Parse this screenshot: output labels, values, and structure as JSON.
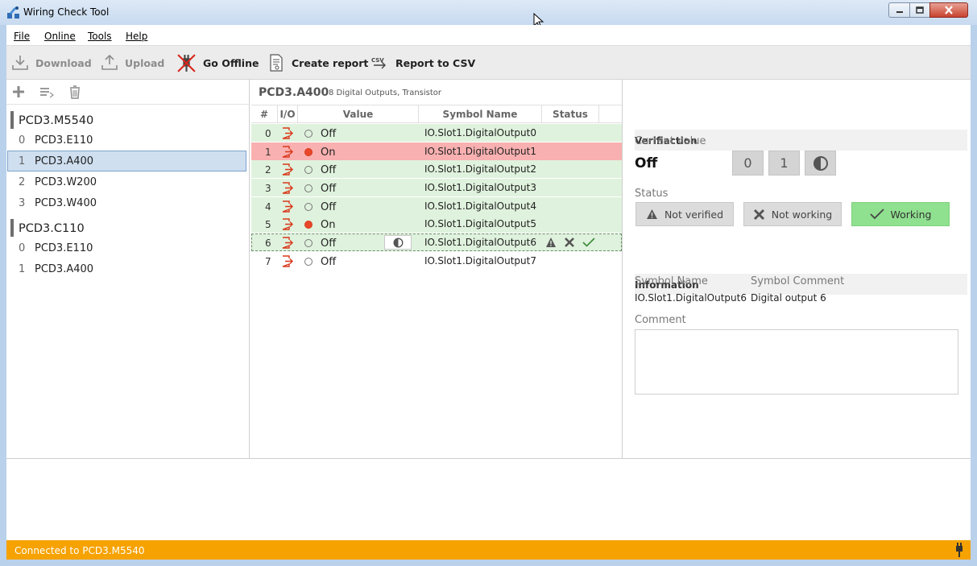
{
  "window": {
    "title": "Wiring Check Tool"
  },
  "menu": {
    "items": [
      "File",
      "Online",
      "Tools",
      "Help"
    ]
  },
  "toolbar": {
    "download_label": "Download",
    "upload_label": "Upload",
    "go_offline_label": "Go Offline",
    "create_report_label": "Create report",
    "report_csv_label": "Report to CSV"
  },
  "tree": {
    "groups": [
      {
        "name": "PCD3.M5540",
        "items": [
          {
            "idx": "0",
            "name": "PCD3.E110"
          },
          {
            "idx": "1",
            "name": "PCD3.A400",
            "selected": true
          },
          {
            "idx": "2",
            "name": "PCD3.W200"
          },
          {
            "idx": "3",
            "name": "PCD3.W400"
          }
        ]
      },
      {
        "name": "PCD3.C110",
        "items": [
          {
            "idx": "0",
            "name": "PCD3.E110"
          },
          {
            "idx": "1",
            "name": "PCD3.A400"
          }
        ]
      }
    ]
  },
  "module": {
    "title": "PCD3.A400",
    "subtitle": "8 Digital Outputs, Transistor"
  },
  "grid": {
    "headers": {
      "num": "#",
      "io": "I/O",
      "value": "Value",
      "symbol": "Symbol Name",
      "status": "Status"
    },
    "rows": [
      {
        "num": "0",
        "value": "Off",
        "on": false,
        "symbol": "IO.Slot1.DigitalOutput0",
        "state": "ok"
      },
      {
        "num": "1",
        "value": "On",
        "on": true,
        "symbol": "IO.Slot1.DigitalOutput1",
        "state": "fail"
      },
      {
        "num": "2",
        "value": "Off",
        "on": false,
        "symbol": "IO.Slot1.DigitalOutput2",
        "state": "ok"
      },
      {
        "num": "3",
        "value": "Off",
        "on": false,
        "symbol": "IO.Slot1.DigitalOutput3",
        "state": "ok"
      },
      {
        "num": "4",
        "value": "Off",
        "on": false,
        "symbol": "IO.Slot1.DigitalOutput4",
        "state": "ok"
      },
      {
        "num": "5",
        "value": "On",
        "on": true,
        "symbol": "IO.Slot1.DigitalOutput5",
        "state": "ok"
      },
      {
        "num": "6",
        "value": "Off",
        "on": false,
        "symbol": "IO.Slot1.DigitalOutput6",
        "state": "selected"
      },
      {
        "num": "7",
        "value": "Off",
        "on": false,
        "symbol": "IO.Slot1.DigitalOutput7",
        "state": "none"
      }
    ]
  },
  "verification": {
    "section_title": "Verifiaction",
    "current_value_label": "Current value",
    "current_value": "Off",
    "btn_zero": "0",
    "btn_one": "1",
    "status_label": "Status",
    "not_verified_label": "Not verified",
    "not_working_label": "Not working",
    "working_label": "Working"
  },
  "information": {
    "section_title": "Information",
    "symbol_name_label": "Symbol Name",
    "symbol_name_value": "IO.Slot1.DigitalOutput6",
    "symbol_comment_label": "Symbol Comment",
    "symbol_comment_value": "Digital output 6",
    "comment_label": "Comment",
    "comment_value": ""
  },
  "statusbar": {
    "text": "Connected to PCD3.M5540"
  },
  "colors": {
    "ok_row": "#dff2dd",
    "fail_row": "#f9b0b0",
    "on_dot": "#e8472a",
    "io_icon": "#d9391c",
    "working": "#8fe08f",
    "status_bar": "#f6a200",
    "selection": "#cfdff0"
  }
}
